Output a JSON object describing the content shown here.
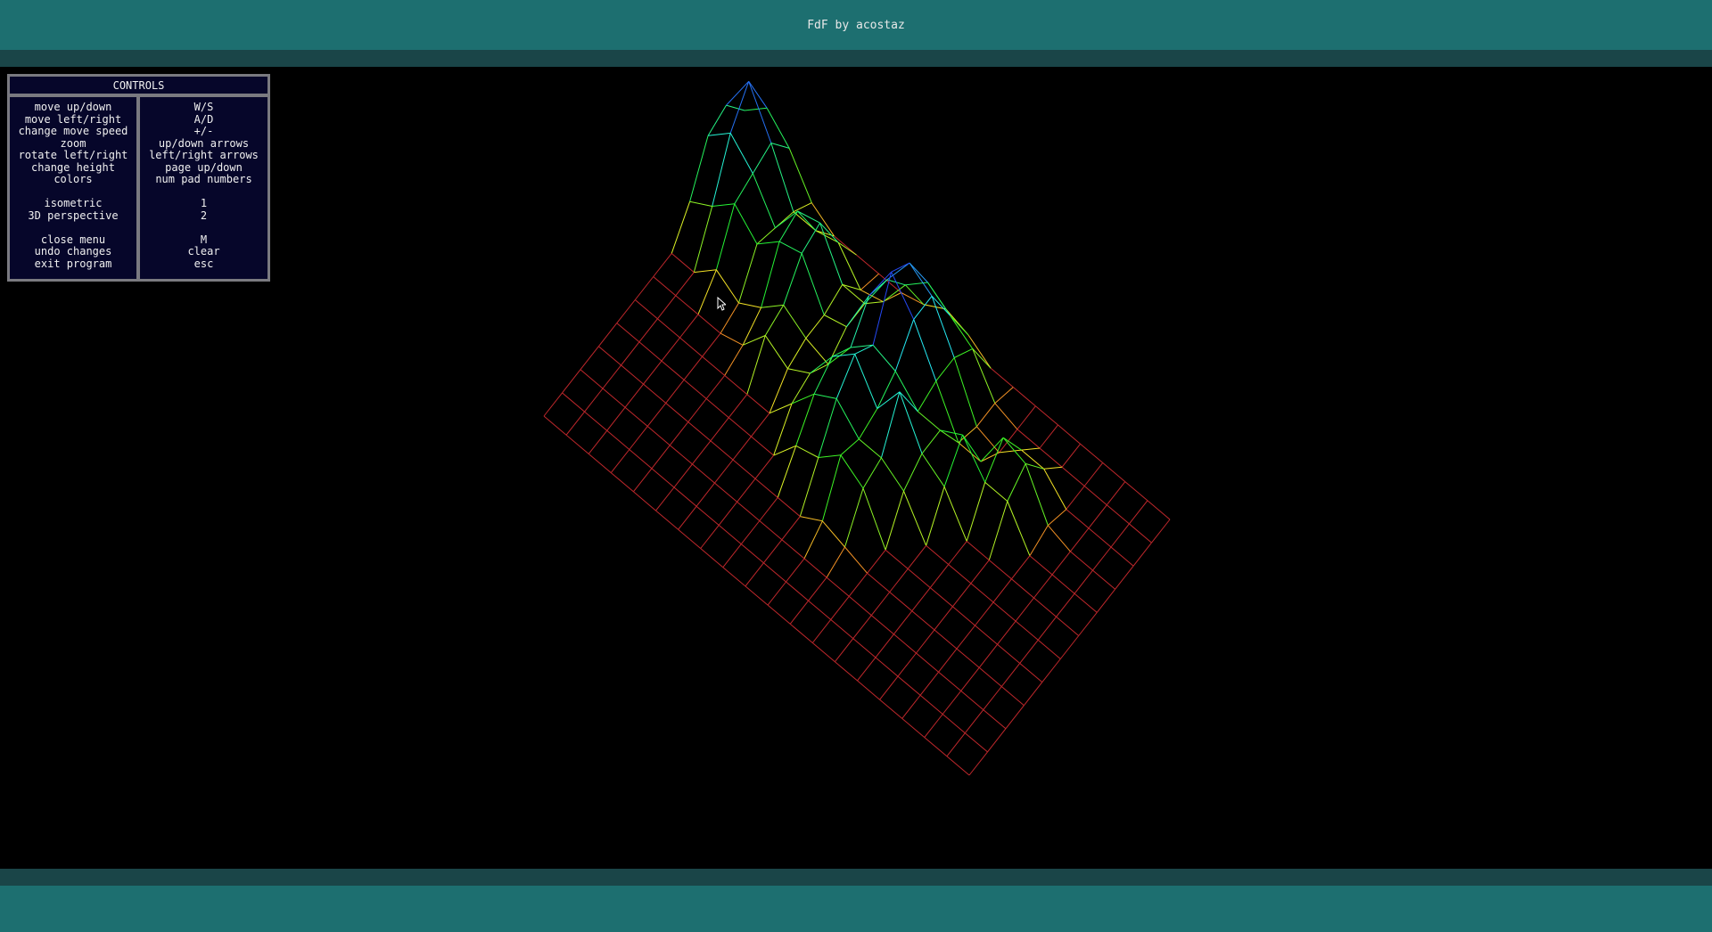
{
  "window": {
    "title": "FdF by acostaz"
  },
  "menu": {
    "header": "CONTROLS",
    "groups": [
      [
        {
          "action": "move up/down",
          "key": "W/S"
        },
        {
          "action": "move left/right",
          "key": "A/D"
        },
        {
          "action": "change move speed",
          "key": "+/-"
        },
        {
          "action": "zoom",
          "key": "up/down arrows"
        },
        {
          "action": "rotate left/right",
          "key": "left/right arrows"
        },
        {
          "action": "change height",
          "key": "page up/down"
        },
        {
          "action": "colors",
          "key": "num pad numbers"
        }
      ],
      [
        {
          "action": "isometric",
          "key": "1"
        },
        {
          "action": "3D perspective",
          "key": "2"
        }
      ],
      [
        {
          "action": "close menu",
          "key": "M"
        },
        {
          "action": "undo changes",
          "key": "clear"
        },
        {
          "action": "exit program",
          "key": "esc"
        }
      ]
    ]
  },
  "colors": {
    "titlebar": "#1d6f70",
    "strip": "#1a4548",
    "menu_bg": "#06062a",
    "menu_border": "#7a7a80",
    "base_grid": "#c0282c",
    "peak_top": "#3a1ad0"
  },
  "wireframe": {
    "projection": "isometric",
    "grid_cols": 19,
    "grid_rows": 11
  }
}
